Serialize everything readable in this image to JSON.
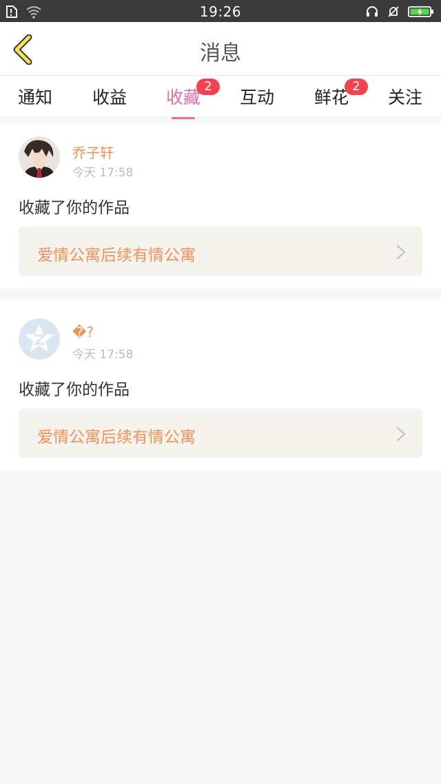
{
  "status_bar": {
    "time": "19:26"
  },
  "header": {
    "title": "消息"
  },
  "tabs": [
    {
      "label": "通知",
      "badge": ""
    },
    {
      "label": "收益",
      "badge": ""
    },
    {
      "label": "收藏",
      "badge": "2",
      "active": true
    },
    {
      "label": "互动",
      "badge": ""
    },
    {
      "label": "鲜花",
      "badge": "2"
    },
    {
      "label": "关注",
      "badge": ""
    }
  ],
  "messages": [
    {
      "username": "乔子轩",
      "time": "今天 17:58",
      "action": "收藏了你的作品",
      "work_title": "爱情公寓后续有情公寓"
    },
    {
      "username": "�?",
      "time": "今天 17:58",
      "action": "收藏了你的作品",
      "work_title": "爱情公寓后续有情公寓"
    }
  ],
  "colors": {
    "accent_pink": "#e46e9f",
    "username_orange": "#f0915a",
    "badge_red": "#f2424d",
    "back_yellow": "#f3e35c",
    "battery_green": "#56d84a"
  }
}
